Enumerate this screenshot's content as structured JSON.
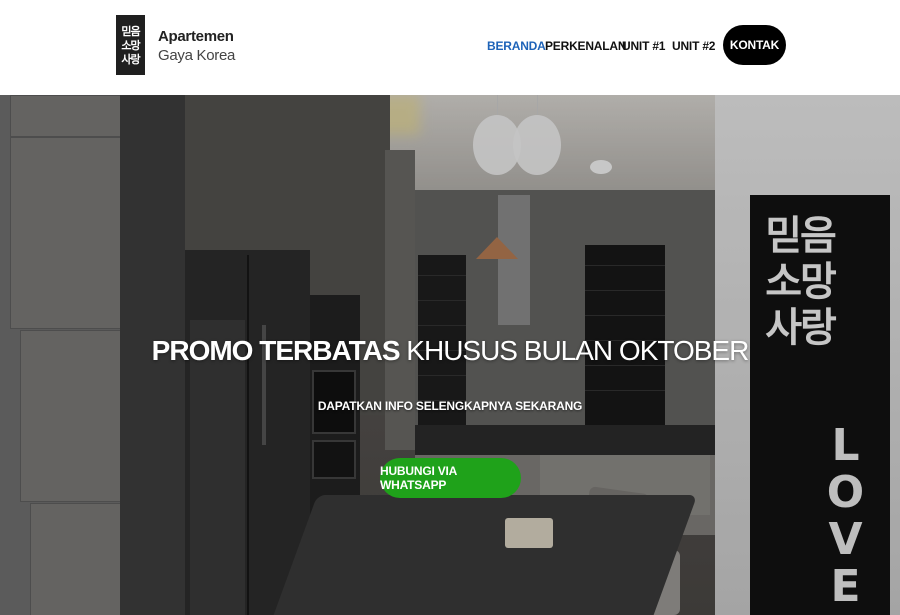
{
  "brand": {
    "logo_glyphs": [
      "믿음",
      "소망",
      "사랑"
    ],
    "title": "Apartemen",
    "subtitle": "Gaya Korea"
  },
  "nav": {
    "items": [
      {
        "label": "BERANDA",
        "active": true
      },
      {
        "label": "PERKENALAN",
        "active": false
      },
      {
        "label": "UNIT #1",
        "active": false
      },
      {
        "label": "UNIT #2",
        "active": false
      }
    ],
    "cta_label": "KONTAK"
  },
  "hero": {
    "title_strong": "PROMO TERBATAS",
    "title_light": "KHUSUS BULAN OKTOBER",
    "subtitle": "DAPATKAN INFO SELENGKAPNYA SEKARANG",
    "cta_label": "HUBUNGI VIA WHATSAPP",
    "banner_glyphs": "믿음\n소망\n사랑",
    "banner_word": "LOVE"
  },
  "colors": {
    "active_nav": "#1e63b8",
    "cta_green": "#1fa21a",
    "contact_button": "#000000"
  }
}
